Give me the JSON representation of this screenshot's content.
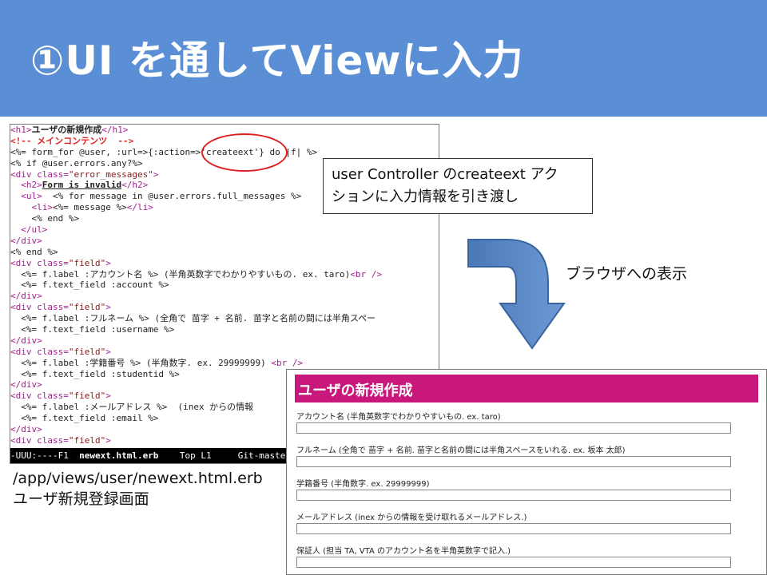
{
  "slide": {
    "title": "①UI を通してViewに入力"
  },
  "editor": {
    "code_lines": [
      [
        {
          "t": "<h1>",
          "c": "tag"
        },
        {
          "t": "ユーザの新規作成",
          "c": "bold"
        },
        {
          "t": "</h1>",
          "c": "tag"
        }
      ],
      [
        {
          "t": "<!-- メインコンテンツ  -->",
          "c": "cmt"
        }
      ],
      [
        {
          "t": "<%= form_for @user, :url=>{:action=>'createext'} do |f| %>",
          "c": ""
        }
      ],
      [
        {
          "t": "<% if @user.errors.any?%>",
          "c": ""
        }
      ],
      [
        {
          "t": "<div ",
          "c": "tag"
        },
        {
          "t": "class=",
          "c": "tag"
        },
        {
          "t": "\"error_messages\"",
          "c": "str"
        },
        {
          "t": ">",
          "c": "tag"
        }
      ],
      [
        {
          "t": "  <h2>",
          "c": "tag"
        },
        {
          "t": "Form is invalid",
          "c": "ul"
        },
        {
          "t": "</h2>",
          "c": "tag"
        }
      ],
      [
        {
          "t": "  <ul>",
          "c": "tag"
        },
        {
          "t": "  <% for message in @user.errors.full_messages %>",
          "c": ""
        }
      ],
      [
        {
          "t": "    <li>",
          "c": "tag"
        },
        {
          "t": "<%= message %>",
          "c": ""
        },
        {
          "t": "</li>",
          "c": "tag"
        }
      ],
      [
        {
          "t": "    <% end %>",
          "c": ""
        }
      ],
      [
        {
          "t": "  </ul>",
          "c": "tag"
        }
      ],
      [
        {
          "t": "</div>",
          "c": "tag"
        }
      ],
      [
        {
          "t": "<% end %>",
          "c": ""
        }
      ],
      [
        {
          "t": "<div ",
          "c": "tag"
        },
        {
          "t": "class=",
          "c": "tag"
        },
        {
          "t": "\"field\"",
          "c": "str"
        },
        {
          "t": ">",
          "c": "tag"
        }
      ],
      [
        {
          "t": "  <%= f.label :アカウント名 %> (半角英数字でわかりやすいもの. ex. taro)",
          "c": ""
        },
        {
          "t": "<br />",
          "c": "tag"
        }
      ],
      [
        {
          "t": "  <%= f.text_field :account %>",
          "c": ""
        }
      ],
      [
        {
          "t": "</div>",
          "c": "tag"
        }
      ],
      [
        {
          "t": "<div ",
          "c": "tag"
        },
        {
          "t": "class=",
          "c": "tag"
        },
        {
          "t": "\"field\"",
          "c": "str"
        },
        {
          "t": ">",
          "c": "tag"
        }
      ],
      [
        {
          "t": "  <%= f.label :フルネーム %> (全角で 苗字 + 名前. 苗字と名前の間には半角スペー",
          "c": ""
        }
      ],
      [
        {
          "t": "  <%= f.text_field :username %>",
          "c": ""
        }
      ],
      [
        {
          "t": "</div>",
          "c": "tag"
        }
      ],
      [
        {
          "t": "<div ",
          "c": "tag"
        },
        {
          "t": "class=",
          "c": "tag"
        },
        {
          "t": "\"field\"",
          "c": "str"
        },
        {
          "t": ">",
          "c": "tag"
        }
      ],
      [
        {
          "t": "  <%= f.label :学籍番号 %> (半角数字. ex. 29999999) ",
          "c": ""
        },
        {
          "t": "<br />",
          "c": "tag"
        }
      ],
      [
        {
          "t": "  <%= f.text_field :studentid %>",
          "c": ""
        }
      ],
      [
        {
          "t": "</div>",
          "c": "tag"
        }
      ],
      [
        {
          "t": "<div ",
          "c": "tag"
        },
        {
          "t": "class=",
          "c": "tag"
        },
        {
          "t": "\"field\"",
          "c": "str"
        },
        {
          "t": ">",
          "c": "tag"
        }
      ],
      [
        {
          "t": "  <%= f.label :メールアドレス %>  (inex からの情報",
          "c": ""
        }
      ],
      [
        {
          "t": "  <%= f.text_field :email %>",
          "c": ""
        }
      ],
      [
        {
          "t": "</div>",
          "c": "tag"
        }
      ],
      [
        {
          "t": "<div ",
          "c": "tag"
        },
        {
          "t": "class=",
          "c": "tag"
        },
        {
          "t": "\"field\"",
          "c": "str"
        },
        {
          "t": ">",
          "c": "tag"
        }
      ]
    ],
    "status": {
      "mode": "-UUU:----F1  ",
      "filename": "newext.html.erb",
      "position": "    Top L1     ",
      "branch": "Git-maste"
    }
  },
  "callout": {
    "line1": "user Controller のcreateext アク",
    "line2": "ションに入力情報を引き渡し"
  },
  "arrow_label": "ブラウザへの表示",
  "caption": {
    "path": "/app/views/user/newext.html.erb",
    "description": "ユーザ新規登録画面"
  },
  "browser": {
    "heading": "ユーザの新規作成",
    "accent_color": "#c8187c",
    "fields": [
      {
        "label": "アカウント名 (半角英数字でわかりやすいもの. ex. taro)"
      },
      {
        "label": "フルネーム (全角で 苗字 + 名前. 苗字と名前の間には半角スペースをいれる. ex. 坂本 太郎)"
      },
      {
        "label": "学籍番号 (半角数字. ex. 29999999)"
      },
      {
        "label": "メールアドレス (inex からの情報を受け取れるメールアドレス.)"
      },
      {
        "label": "保証人 (担当 TA, VTA のアカウント名を半角英数字で記入.)"
      }
    ]
  }
}
